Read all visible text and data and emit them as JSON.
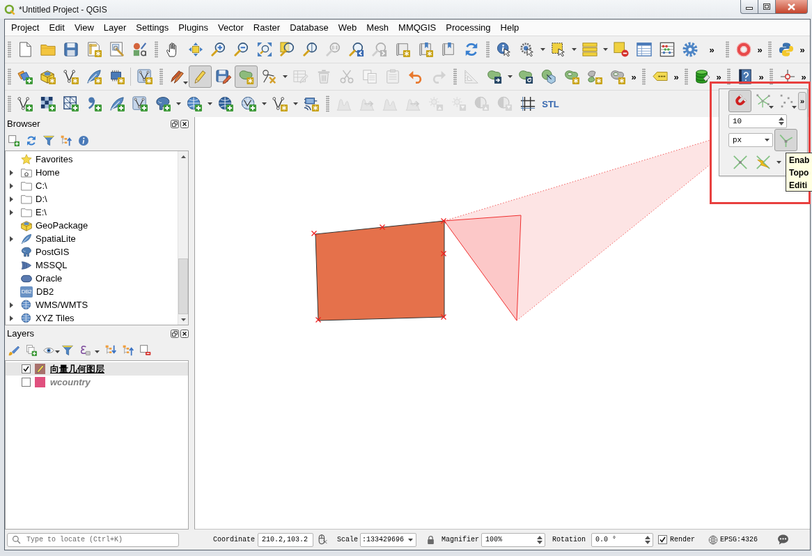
{
  "window": {
    "title": "*Untitled Project - QGIS"
  },
  "menu": [
    {
      "label": "Project"
    },
    {
      "label": "Edit"
    },
    {
      "label": "View"
    },
    {
      "label": "Layer"
    },
    {
      "label": "Settings"
    },
    {
      "label": "Plugins"
    },
    {
      "label": "Vector"
    },
    {
      "label": "Raster"
    },
    {
      "label": "Database"
    },
    {
      "label": "Web"
    },
    {
      "label": "Mesh"
    },
    {
      "label": "MMQGIS"
    },
    {
      "label": "Processing"
    },
    {
      "label": "Help"
    }
  ],
  "toolbars": [
    {
      "groups": [
        {
          "kind": "grip",
          "items": [
            {
              "kind": "page",
              "disabled": false,
              "pressed": false
            },
            {
              "kind": "folder",
              "disabled": false,
              "pressed": false
            },
            {
              "kind": "floppy",
              "disabled": false,
              "pressed": false
            },
            {
              "kind": "ruled-page-star",
              "disabled": false,
              "pressed": false
            },
            {
              "kind": "page-wrench",
              "disabled": false,
              "pressed": false
            },
            {
              "kind": "style-shapes",
              "disabled": false,
              "pressed": false
            }
          ]
        },
        {
          "kind": "grip",
          "items": [
            {
              "kind": "hand",
              "disabled": false,
              "pressed": false
            },
            {
              "kind": "pan-arrows",
              "disabled": false,
              "pressed": false
            },
            {
              "kind": "zoom-in",
              "disabled": false,
              "pressed": false
            },
            {
              "kind": "zoom-out",
              "disabled": false,
              "pressed": false
            },
            {
              "kind": "zoom-full",
              "disabled": false,
              "pressed": false
            },
            {
              "kind": "zoom-layer",
              "disabled": false,
              "pressed": false
            },
            {
              "kind": "zoom-selection",
              "disabled": false,
              "pressed": false
            },
            {
              "kind": "zoom-native",
              "disabled": true,
              "pressed": false
            },
            {
              "kind": "zoom-last",
              "disabled": false,
              "pressed": false
            },
            {
              "kind": "zoom-next",
              "disabled": true,
              "pressed": false
            },
            {
              "kind": "scroll-star",
              "disabled": false,
              "pressed": false
            },
            {
              "kind": "scroll-pin-star",
              "disabled": false,
              "pressed": false
            },
            {
              "kind": "scroll-pin",
              "disabled": false,
              "pressed": false
            },
            {
              "kind": "refresh",
              "disabled": false,
              "pressed": false
            }
          ]
        },
        {
          "kind": "grip",
          "items": [
            {
              "kind": "info-cursor",
              "disabled": false,
              "pressed": false
            },
            {
              "kind": "gear-cursor",
              "disabled": false,
              "pressed": false,
              "menu": true
            },
            {
              "kind": "select-cursor",
              "disabled": false,
              "pressed": false,
              "menu": true
            },
            {
              "kind": "stacked-bars",
              "disabled": false,
              "pressed": false,
              "menu": true
            },
            {
              "kind": "deselect",
              "disabled": false,
              "pressed": false
            },
            {
              "kind": "table",
              "disabled": false,
              "pressed": false
            },
            {
              "kind": "abacus",
              "disabled": false,
              "pressed": false
            },
            {
              "kind": "gear",
              "disabled": false,
              "pressed": false
            }
          ],
          "more": "»"
        },
        {
          "kind": "grip",
          "items": [
            {
              "kind": "ring",
              "disabled": false,
              "pressed": false
            }
          ],
          "more": "»"
        },
        {
          "kind": "grip",
          "items": [
            {
              "kind": "snake",
              "disabled": false,
              "pressed": false
            }
          ],
          "more": "»"
        }
      ]
    },
    {
      "groups": [
        {
          "kind": "grip",
          "items": [
            {
              "kind": "layers-plus",
              "disabled": false,
              "pressed": false
            },
            {
              "kind": "cube-star",
              "disabled": false,
              "pressed": false
            },
            {
              "kind": "vertex-star",
              "disabled": false,
              "pressed": false
            },
            {
              "kind": "feather-star",
              "disabled": false,
              "pressed": false
            },
            {
              "kind": "chip-star",
              "disabled": false,
              "pressed": false
            }
          ]
        },
        {
          "kind": "line",
          "items": [
            {
              "kind": "vertex-box-star",
              "disabled": false,
              "pressed": false
            }
          ]
        },
        {
          "kind": "grip",
          "items": [
            {
              "kind": "pencils",
              "disabled": false,
              "pressed": false,
              "popup": true
            },
            {
              "kind": "pencil",
              "disabled": false,
              "pressed": true
            },
            {
              "kind": "floppy-pencil",
              "disabled": false,
              "pressed": false
            },
            {
              "kind": "polygon-star",
              "disabled": false,
              "pressed": true
            },
            {
              "kind": "vertex-tools",
              "disabled": false,
              "pressed": false,
              "menu": true
            },
            {
              "kind": "table-pencil",
              "disabled": true,
              "pressed": false
            },
            {
              "kind": "trash",
              "disabled": true,
              "pressed": false
            },
            {
              "kind": "scissors",
              "disabled": true,
              "pressed": false
            },
            {
              "kind": "copy",
              "disabled": true,
              "pressed": false
            },
            {
              "kind": "clipboard",
              "disabled": true,
              "pressed": false
            },
            {
              "kind": "undo",
              "disabled": false,
              "pressed": false
            },
            {
              "kind": "redo",
              "disabled": true,
              "pressed": false
            }
          ]
        },
        {
          "kind": "grip",
          "items": [
            {
              "kind": "set-square",
              "disabled": true,
              "pressed": false
            },
            {
              "kind": "polygon-arrow",
              "disabled": false,
              "pressed": false,
              "menu": true
            },
            {
              "kind": "polygon-rotate",
              "disabled": false,
              "pressed": false
            },
            {
              "kind": "circle-hexagon",
              "disabled": false,
              "pressed": false
            },
            {
              "kind": "polygon-hole",
              "disabled": false,
              "pressed": false
            },
            {
              "kind": "polygon-pair",
              "disabled": false,
              "pressed": false
            },
            {
              "kind": "polygon-hole-grey",
              "disabled": false,
              "pressed": false
            }
          ],
          "more": "»"
        },
        {
          "kind": "grip",
          "items": [
            {
              "kind": "label-tag",
              "disabled": false,
              "pressed": false
            }
          ],
          "more": "»"
        },
        {
          "kind": "grip",
          "items": [
            {
              "kind": "database-plug",
              "disabled": false,
              "pressed": false
            }
          ],
          "more": "»"
        },
        {
          "kind": "grip",
          "items": [
            {
              "kind": "help-book",
              "disabled": false,
              "pressed": false
            }
          ],
          "more": "»"
        },
        {
          "kind": "grip",
          "items": [
            {
              "kind": "crosshair",
              "disabled": false,
              "pressed": false
            }
          ],
          "more": "»"
        }
      ]
    },
    {
      "groups": [
        {
          "kind": "grip",
          "items": [
            {
              "kind": "vertex-plus",
              "disabled": false,
              "pressed": false
            },
            {
              "kind": "checker-plus",
              "disabled": false,
              "pressed": false
            },
            {
              "kind": "mesh-plus",
              "disabled": false,
              "pressed": false
            },
            {
              "kind": "comma-plus",
              "disabled": false,
              "pressed": false
            },
            {
              "kind": "feather-plus",
              "disabled": false,
              "pressed": false
            },
            {
              "kind": "vertex-box-plus",
              "disabled": false,
              "pressed": false
            },
            {
              "kind": "elephant-plus",
              "disabled": false,
              "pressed": false,
              "menu": true
            },
            {
              "kind": "globe-plus",
              "disabled": false,
              "pressed": false,
              "menu": true
            },
            {
              "kind": "globe-grid-plus",
              "disabled": false,
              "pressed": false
            },
            {
              "kind": "globe-vertex-plus",
              "disabled": false,
              "pressed": false,
              "menu": true
            },
            {
              "kind": "vertex-star",
              "disabled": false,
              "pressed": false,
              "menu": true
            },
            {
              "kind": "server-star",
              "disabled": false,
              "pressed": false
            }
          ]
        },
        {
          "kind": "grip",
          "items": [
            {
              "kind": "histogram",
              "disabled": true,
              "pressed": false
            },
            {
              "kind": "histogram-arrows",
              "disabled": true,
              "pressed": false
            },
            {
              "kind": "histogram",
              "disabled": true,
              "pressed": false
            },
            {
              "kind": "histogram-arrows",
              "disabled": true,
              "pressed": false
            },
            {
              "kind": "sun-up",
              "disabled": true,
              "pressed": false
            },
            {
              "kind": "sun-down",
              "disabled": true,
              "pressed": false
            },
            {
              "kind": "half-circle-up",
              "disabled": true,
              "pressed": false
            },
            {
              "kind": "half-circle-down",
              "disabled": true,
              "pressed": false
            },
            {
              "kind": "grid-lines",
              "disabled": false,
              "pressed": false
            },
            {
              "kind": "text",
              "text": "STL",
              "disabled": false,
              "pressed": false
            }
          ]
        }
      ]
    }
  ],
  "browser": {
    "title": "Browser",
    "items": [
      {
        "label": "Favorites",
        "kind": "star",
        "expandable": false
      },
      {
        "label": "Home",
        "kind": "home",
        "expandable": true,
        "expanded": false
      },
      {
        "label": "C:\\",
        "kind": "folder",
        "expandable": true,
        "expanded": false
      },
      {
        "label": "D:\\",
        "kind": "folder",
        "expandable": true,
        "expanded": false
      },
      {
        "label": "E:\\",
        "kind": "folder",
        "expandable": true,
        "expanded": false
      },
      {
        "label": "GeoPackage",
        "kind": "cube",
        "expandable": false
      },
      {
        "label": "SpatiaLite",
        "kind": "feather",
        "expandable": true,
        "expanded": false
      },
      {
        "label": "PostGIS",
        "kind": "elephant",
        "expandable": false
      },
      {
        "label": "MSSQL",
        "kind": "fan",
        "expandable": false
      },
      {
        "label": "Oracle",
        "kind": "capsule",
        "expandable": false
      },
      {
        "label": "DB2",
        "kind": "tile",
        "icon_text": "DB2",
        "expandable": false
      },
      {
        "label": "WMS/WMTS",
        "kind": "globe",
        "expandable": true,
        "expanded": false
      },
      {
        "label": "XYZ Tiles",
        "kind": "globe",
        "expandable": true,
        "expanded": false
      }
    ]
  },
  "layers": {
    "title": "Layers",
    "items": [
      {
        "name": "向量几何图层",
        "checked": true,
        "selected": true,
        "editing": true,
        "greyed": false,
        "color": "#a8706c"
      },
      {
        "name": "wcountry",
        "checked": false,
        "selected": false,
        "editing": false,
        "greyed": true,
        "color": "#e0507e"
      }
    ]
  },
  "snapping": {
    "items": [
      {
        "kind": "magnet",
        "pressed": true
      },
      {
        "kind": "vertex-network",
        "pressed": false,
        "popup": true
      },
      {
        "kind": "scattered-dots",
        "pressed": false,
        "popup": true
      }
    ],
    "more": "»",
    "tolerance": "10",
    "units": "px",
    "topology": {
      "kind": "junction",
      "pressed": true
    },
    "tools": [
      {
        "kind": "cross-lines",
        "pressed": false
      },
      {
        "kind": "lightning-cross",
        "pressed": false,
        "menu": true
      }
    ]
  },
  "tooltip": {
    "lines": [
      "Enab",
      "Topo",
      "Editi"
    ]
  },
  "status_bar": {
    "locator": {
      "placeholder": "Type to locate (Ctrl+K)"
    },
    "coordinate": {
      "label": "Coordinate",
      "value": "210.2,103.2"
    },
    "scale": {
      "label": "Scale",
      "value": ":133429696"
    },
    "magnifier": {
      "label": "Magnifier",
      "value": "100%"
    },
    "rotation": {
      "label": "Rotation",
      "value": "0.0 °"
    },
    "render": {
      "label": "Render",
      "checked": true
    },
    "crs": "EPSG:4326"
  }
}
